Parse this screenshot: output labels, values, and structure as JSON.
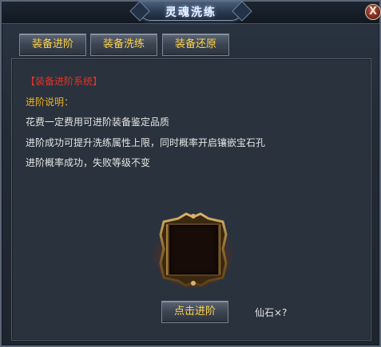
{
  "window": {
    "title": "灵魂洗练",
    "close_label": "X"
  },
  "tabs": [
    {
      "label": "装备进阶"
    },
    {
      "label": "装备洗练"
    },
    {
      "label": "装备还原"
    }
  ],
  "panel": {
    "system_title": "【装备进阶系统】",
    "description_header": "进阶说明：",
    "description_lines": [
      "花费一定费用可进阶装备鉴定品质",
      "进阶成功可提升洗练属性上限，同时概率开启镶嵌宝石孔",
      "进阶概率成功，失败等级不变"
    ]
  },
  "action": {
    "button_label": "点击进阶",
    "cost_text": "仙石×?"
  },
  "colors": {
    "tab_text": "#ffd54a",
    "system_title": "#e0352b",
    "description_header": "#f0b020",
    "description_text": "#e6e6e6"
  },
  "icons": {
    "close": "close-icon",
    "slot": "equipment-slot-frame"
  }
}
